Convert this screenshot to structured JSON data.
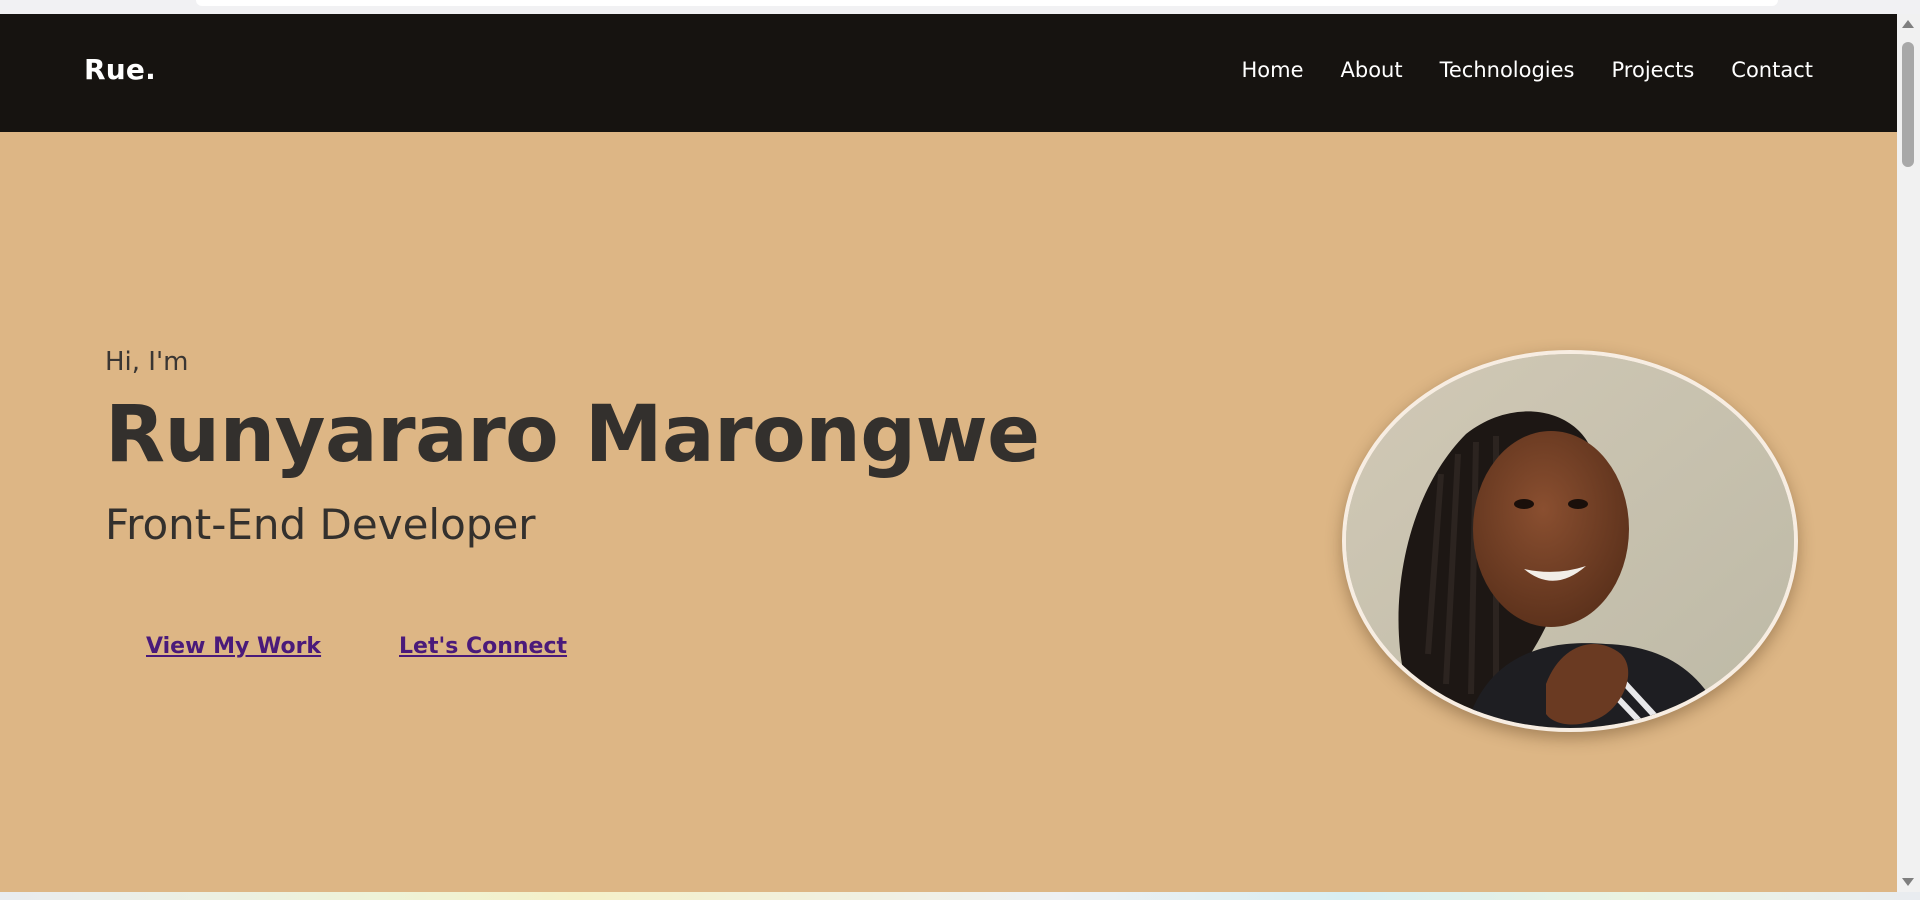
{
  "header": {
    "brand": "Rue.",
    "nav": [
      {
        "label": "Home"
      },
      {
        "label": "About"
      },
      {
        "label": "Technologies"
      },
      {
        "label": "Projects"
      },
      {
        "label": "Contact"
      }
    ]
  },
  "hero": {
    "greeting": "Hi, I'm",
    "name": "Runyararo Marongwe",
    "role": "Front-End Developer",
    "cta_primary": "View My Work",
    "cta_secondary": "Let's Connect",
    "avatar_alt": "Profile photo"
  },
  "colors": {
    "header_bg": "#161310",
    "hero_bg": "#ddb685",
    "text_dark": "#33302d",
    "link": "#4a1a7a"
  }
}
